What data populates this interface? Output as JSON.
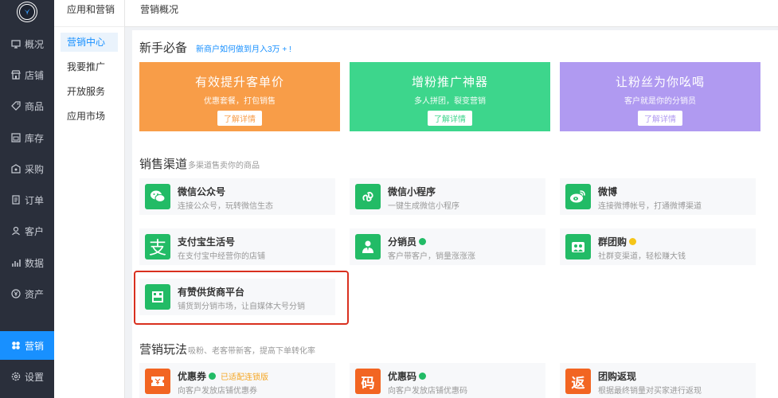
{
  "colors": {
    "sidebar_bg": "#2a2f3b",
    "accent": "#1890ff",
    "banner_orange": "#f89d48",
    "banner_green": "#3dd68c",
    "banner_purple": "#b09af1",
    "wechat_green": "#22bb66",
    "coupon_orange": "#f26522",
    "highlight_red": "#d9301f"
  },
  "nav_primary": [
    {
      "label": "概况",
      "icon": "monitor-icon"
    },
    {
      "label": "店铺",
      "icon": "store-icon"
    },
    {
      "label": "商品",
      "icon": "tag-icon"
    },
    {
      "label": "库存",
      "icon": "inventory-icon"
    },
    {
      "label": "采购",
      "icon": "purchase-icon"
    },
    {
      "label": "订单",
      "icon": "order-icon"
    },
    {
      "label": "客户",
      "icon": "user-icon"
    },
    {
      "label": "数据",
      "icon": "chart-icon"
    },
    {
      "label": "资产",
      "icon": "yen-icon"
    },
    {
      "label": "营销",
      "icon": "marketing-icon",
      "active": true
    },
    {
      "label": "设置",
      "icon": "gear-icon"
    }
  ],
  "nav_secondary": {
    "title": "应用和营销",
    "items": [
      {
        "label": "营销中心",
        "active": true
      },
      {
        "label": "我要推广"
      },
      {
        "label": "开放服务"
      },
      {
        "label": "应用市场"
      }
    ]
  },
  "topbar": {
    "title": "营销概况"
  },
  "newbie": {
    "title": "新手必备",
    "link": "新商户如何做到月入3万 + !",
    "banners": [
      {
        "title": "有效提升客单价",
        "subtitle": "优惠套餐，打包销售",
        "button": "了解详情"
      },
      {
        "title": "增粉推广神器",
        "subtitle": "多人拼团，裂变营销",
        "button": "了解详情"
      },
      {
        "title": "让粉丝为你吆喝",
        "subtitle": "客户就是你的分销员",
        "button": "了解详情"
      }
    ]
  },
  "channels": {
    "title": "销售渠道",
    "subtitle": "多渠道售卖你的商品",
    "cards": [
      {
        "title": "微信公众号",
        "desc": "连接公众号，玩转微信生态",
        "icon": "wechat-icon"
      },
      {
        "title": "微信小程序",
        "desc": "一键生成微信小程序",
        "icon": "miniprogram-icon"
      },
      {
        "title": "微博",
        "desc": "连接微博帐号，打通微博渠道",
        "icon": "weibo-icon"
      },
      {
        "title": "支付宝生活号",
        "desc": "在支付宝中经营你的店铺",
        "icon": "alipay-icon",
        "glyph": "支"
      },
      {
        "title": "分销员",
        "desc": "客户带客户，销量涨涨涨",
        "icon": "distributor-icon"
      },
      {
        "title": "群团购",
        "desc": "社群变渠道，轻松赚大钱",
        "icon": "group-buy-icon"
      },
      {
        "title": "有赞供货商平台",
        "desc": "铺货到分销市场，让自媒体大号分销",
        "icon": "supplier-icon"
      }
    ]
  },
  "promotions": {
    "title": "营销玩法",
    "subtitle": "吸粉、老客带新客，提高下单转化率",
    "cards": [
      {
        "title": "优惠券",
        "desc": "向客户发放店铺优惠券",
        "icon": "coupon-icon",
        "tag": "已适配连锁版"
      },
      {
        "title": "优惠码",
        "desc": "向客户发放店铺优惠码",
        "icon": "promo-code-icon",
        "glyph": "码"
      },
      {
        "title": "团购返现",
        "desc": "根据最终销量对买家进行返现",
        "icon": "cashback-icon",
        "glyph": "返"
      }
    ]
  }
}
